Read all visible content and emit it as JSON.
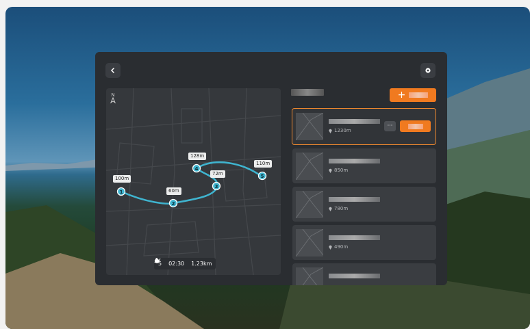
{
  "map": {
    "compass_letter": "N",
    "labels": [
      "100m",
      "60m",
      "128m",
      "72m",
      "110m"
    ],
    "waypoints": [
      "1",
      "2",
      "3",
      "4",
      "5"
    ],
    "stats": {
      "waypoints_count": "5",
      "duration": "02:30",
      "distance": "1.23km"
    }
  },
  "missions": [
    {
      "distance": "1230m",
      "selected": true,
      "more_label": "···"
    },
    {
      "distance": "850m",
      "selected": false
    },
    {
      "distance": "780m",
      "selected": false
    },
    {
      "distance": "490m",
      "selected": false
    },
    {
      "distance": "",
      "selected": false
    }
  ],
  "colors": {
    "accent": "#f07a20",
    "route": "#3fb4cf",
    "panel": "#2a2d31"
  },
  "icons": [
    "back-icon",
    "settings-icon",
    "compass-icon",
    "drone-icon",
    "timer-icon",
    "distance-icon",
    "location-pin-icon",
    "plus-icon"
  ]
}
